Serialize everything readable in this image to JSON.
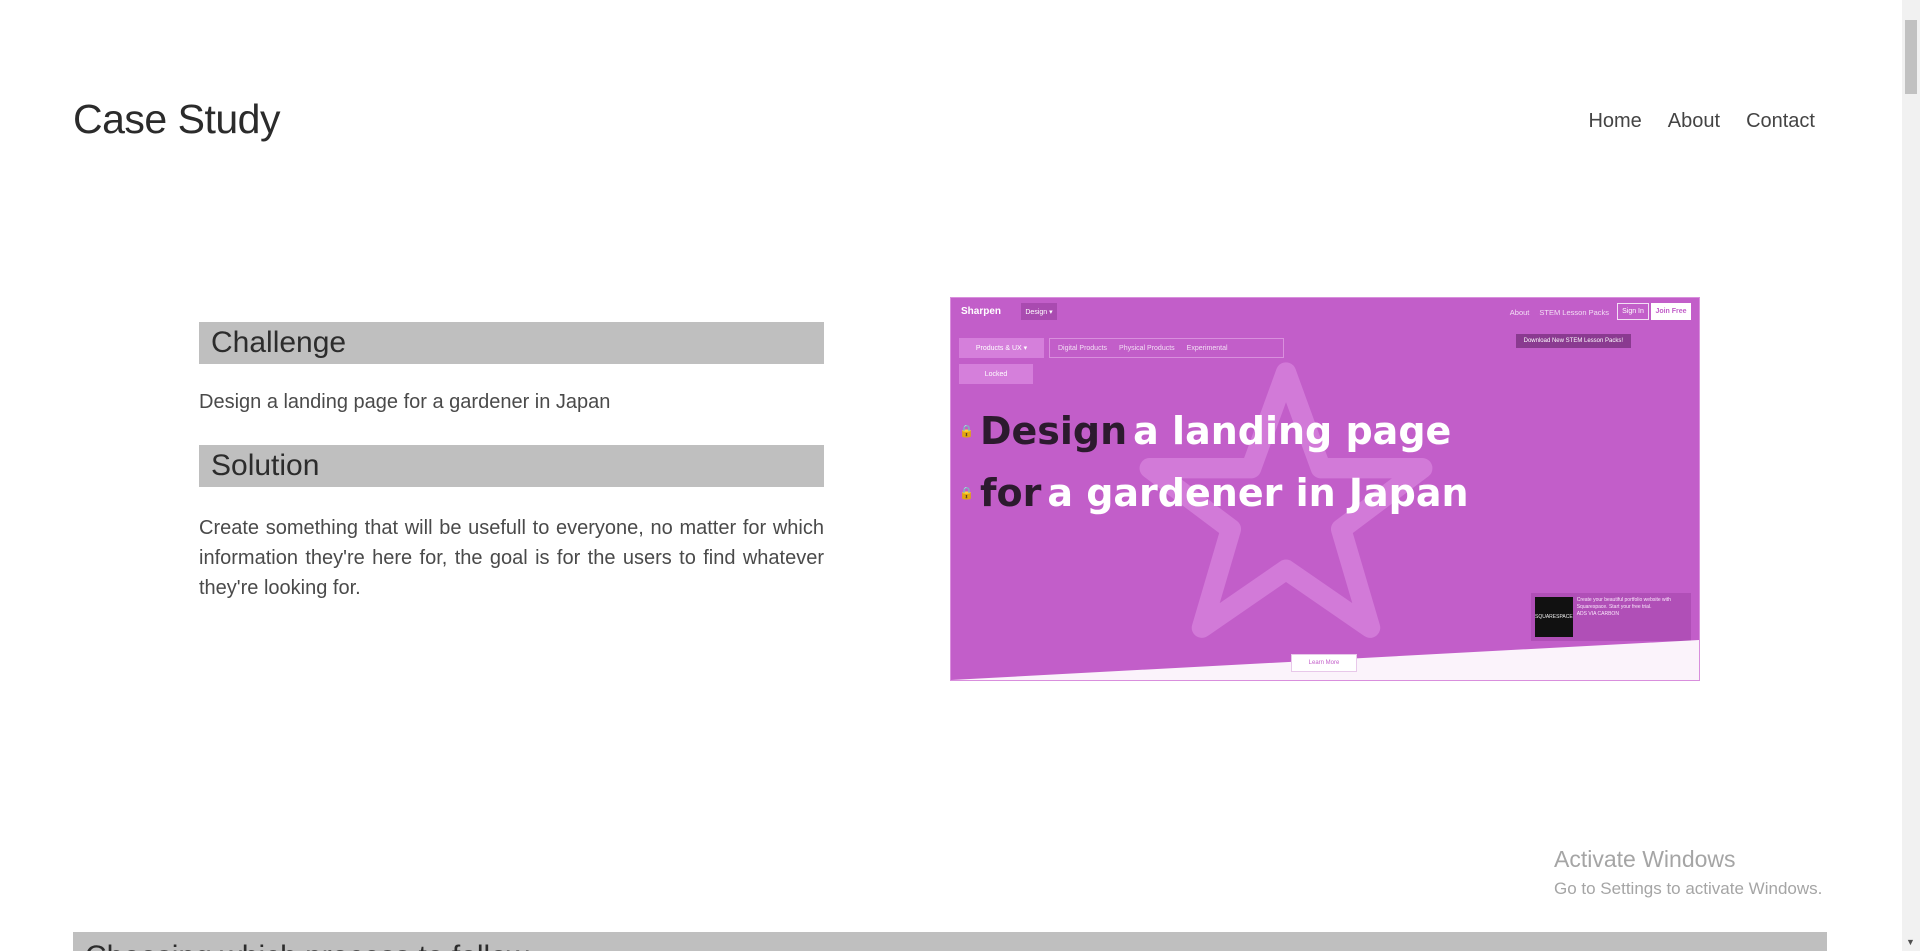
{
  "header": {
    "title": "Case Study",
    "nav": [
      "Home",
      "About",
      "Contact"
    ]
  },
  "challenge": {
    "heading": "Challenge",
    "text": "Design a landing page for a gardener in Japan"
  },
  "solution": {
    "heading": "Solution",
    "text": "Create something that will be usefull to everyone, no matter for which information they're here for, the goal is for the users to find whatever they're looking for."
  },
  "preview": {
    "logo": "Sharpen",
    "design_button": "Design ▾",
    "top_links": [
      "About",
      "STEM Lesson Packs"
    ],
    "sign_in": "Sign In",
    "join_free": "Join Free",
    "category_button": "Products & UX ▾",
    "category_links": [
      "Digital Products",
      "Physical Products",
      "Experimental"
    ],
    "locked": "Locked",
    "download_notice": "Download New STEM Lesson Packs!",
    "headline_line1_dark": "Design",
    "headline_line1_light": "a landing page",
    "headline_line2_dark": "for",
    "headline_line2_light": "a gardener in Japan",
    "lock_glyph": "🔒",
    "ad_brand": "SQUARESPACE",
    "ad_text": "Create your beautiful portfolio website with Squarespace. Start your free trial.",
    "ad_note": "ADS VIA CARBON",
    "learn_more": "Learn More",
    "colors": {
      "background": "#c25ec9",
      "headline_dark": "#2c1a2e"
    }
  },
  "watermark": {
    "title": "Activate Windows",
    "subtitle": "Go to Settings to activate Windows."
  },
  "next_section": {
    "heading": "Choosing which process to follow"
  }
}
